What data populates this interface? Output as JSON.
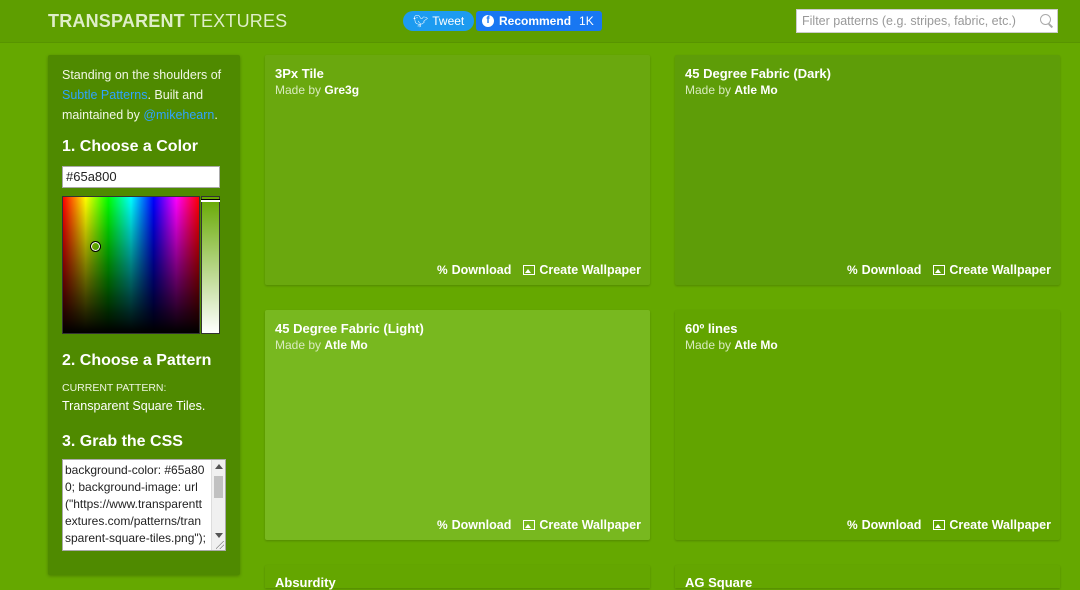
{
  "header": {
    "logo_bold": "TRANSPARENT",
    "logo_light": "TEXTURES",
    "tweet_label": "Tweet",
    "recommend_label": "Recommend",
    "recommend_count": "1K",
    "search_placeholder": "Filter patterns (e.g. stripes, fabric, etc.)"
  },
  "sidebar": {
    "intro_1": "Standing on the shoulders of ",
    "intro_link_1": "Subtle Patterns",
    "intro_2": ". Built and maintained by ",
    "intro_link_2": "@mikehearn",
    "intro_3": ".",
    "step1": "1. Choose a Color",
    "color_value": "#65a800",
    "step2": "2. Choose a Pattern",
    "current_label": "CURRENT PATTERN:",
    "current_value": "Transparent Square Tiles.",
    "step3": "3. Grab the CSS",
    "css_text": "background-color: #65a800;\nbackground-image: url(\"https://www.transparenttextures.com/patterns/transparent-square-tiles.png\");"
  },
  "cards": [
    {
      "title": "3Px Tile",
      "made_by": "Made by",
      "author": "Gre3g",
      "download": "Download",
      "wallpaper": "Create Wallpaper"
    },
    {
      "title": "45 Degree Fabric (Dark)",
      "made_by": "Made by",
      "author": "Atle Mo",
      "download": "Download",
      "wallpaper": "Create Wallpaper"
    },
    {
      "title": "45 Degree Fabric (Light)",
      "made_by": "Made by",
      "author": "Atle Mo",
      "download": "Download",
      "wallpaper": "Create Wallpaper"
    },
    {
      "title": "60º lines",
      "made_by": "Made by",
      "author": "Atle Mo",
      "download": "Download",
      "wallpaper": "Create Wallpaper"
    },
    {
      "title": "Absurdity"
    },
    {
      "title": "AG Square"
    }
  ],
  "colors": {
    "background": "#65a800",
    "tweet": "#1d9bf0",
    "facebook": "#1877f2",
    "link": "#2fa3ff"
  }
}
